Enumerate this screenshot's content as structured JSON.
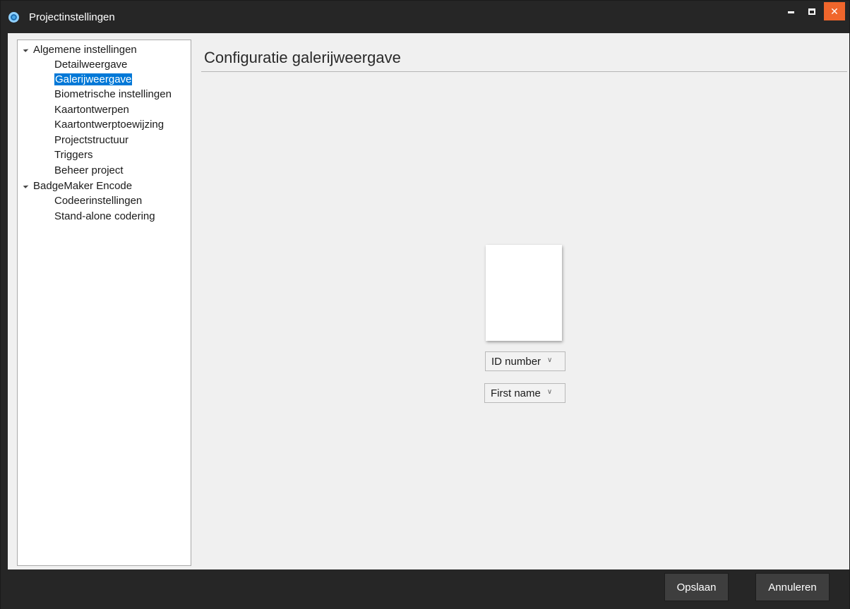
{
  "window": {
    "title": "Projectinstellingen",
    "icon": "app-logo-icon"
  },
  "controls": {
    "minimize": "minimize-icon",
    "maximize": "maximize-icon",
    "close_glyph": "✕"
  },
  "tree": {
    "groups": [
      {
        "label": "Algemene instellingen",
        "items": [
          "Detailweergave",
          "Galerijweergave",
          "Biometrische instellingen",
          "Kaartontwerpen",
          "Kaartontwerptoewijzing",
          "Projectstructuur",
          "Triggers",
          "Beheer project"
        ]
      },
      {
        "label": "BadgeMaker Encode",
        "items": [
          "Codeerinstellingen",
          "Stand-alone codering"
        ]
      }
    ],
    "selected": "Galerijweergave"
  },
  "main": {
    "heading": "Configuratie galerijweergave",
    "dropdown1": {
      "value": "ID number"
    },
    "dropdown2": {
      "value": "First name"
    }
  },
  "footer": {
    "save_label": "Opslaan",
    "cancel_label": "Annuleren"
  },
  "colors": {
    "selection": "#0078d7",
    "close_button": "#f0662c",
    "titlebar": "#262626"
  }
}
